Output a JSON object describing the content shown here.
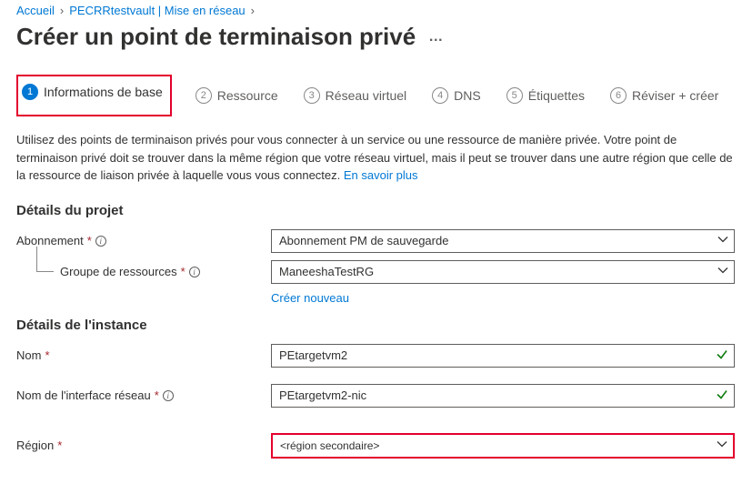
{
  "breadcrumb": {
    "home": "Accueil",
    "vault": "PECRRtestvault | Mise en réseau"
  },
  "page_title": "Créer un point de terminaison privé",
  "tabs": {
    "t1": "Informations de base",
    "t2": "Ressource",
    "t3": "Réseau virtuel",
    "t4": "DNS",
    "t5": "Étiquettes",
    "t6": "Réviser + créer"
  },
  "intro_text": "Utilisez des points de terminaison privés pour vous connecter à un service ou une ressource de manière privée. Votre point de terminaison privé doit se trouver dans la même région que votre réseau virtuel, mais il peut se trouver dans une autre région que celle de la ressource de liaison privée à laquelle vous vous connectez. ",
  "intro_link": "En savoir plus",
  "section1": "Détails du projet",
  "labels": {
    "subscription": "Abonnement",
    "rg": "Groupe de ressources",
    "name": "Nom",
    "nic": "Nom de l'interface réseau",
    "region": "Région"
  },
  "values": {
    "subscription": "Abonnement PM de sauvegarde",
    "rg": "ManeeshaTestRG",
    "name": "PEtargetvm2",
    "nic": "PEtargetvm2-nic",
    "region": "<région secondaire>"
  },
  "create_new": "Créer nouveau",
  "section2": "Détails de l'instance"
}
